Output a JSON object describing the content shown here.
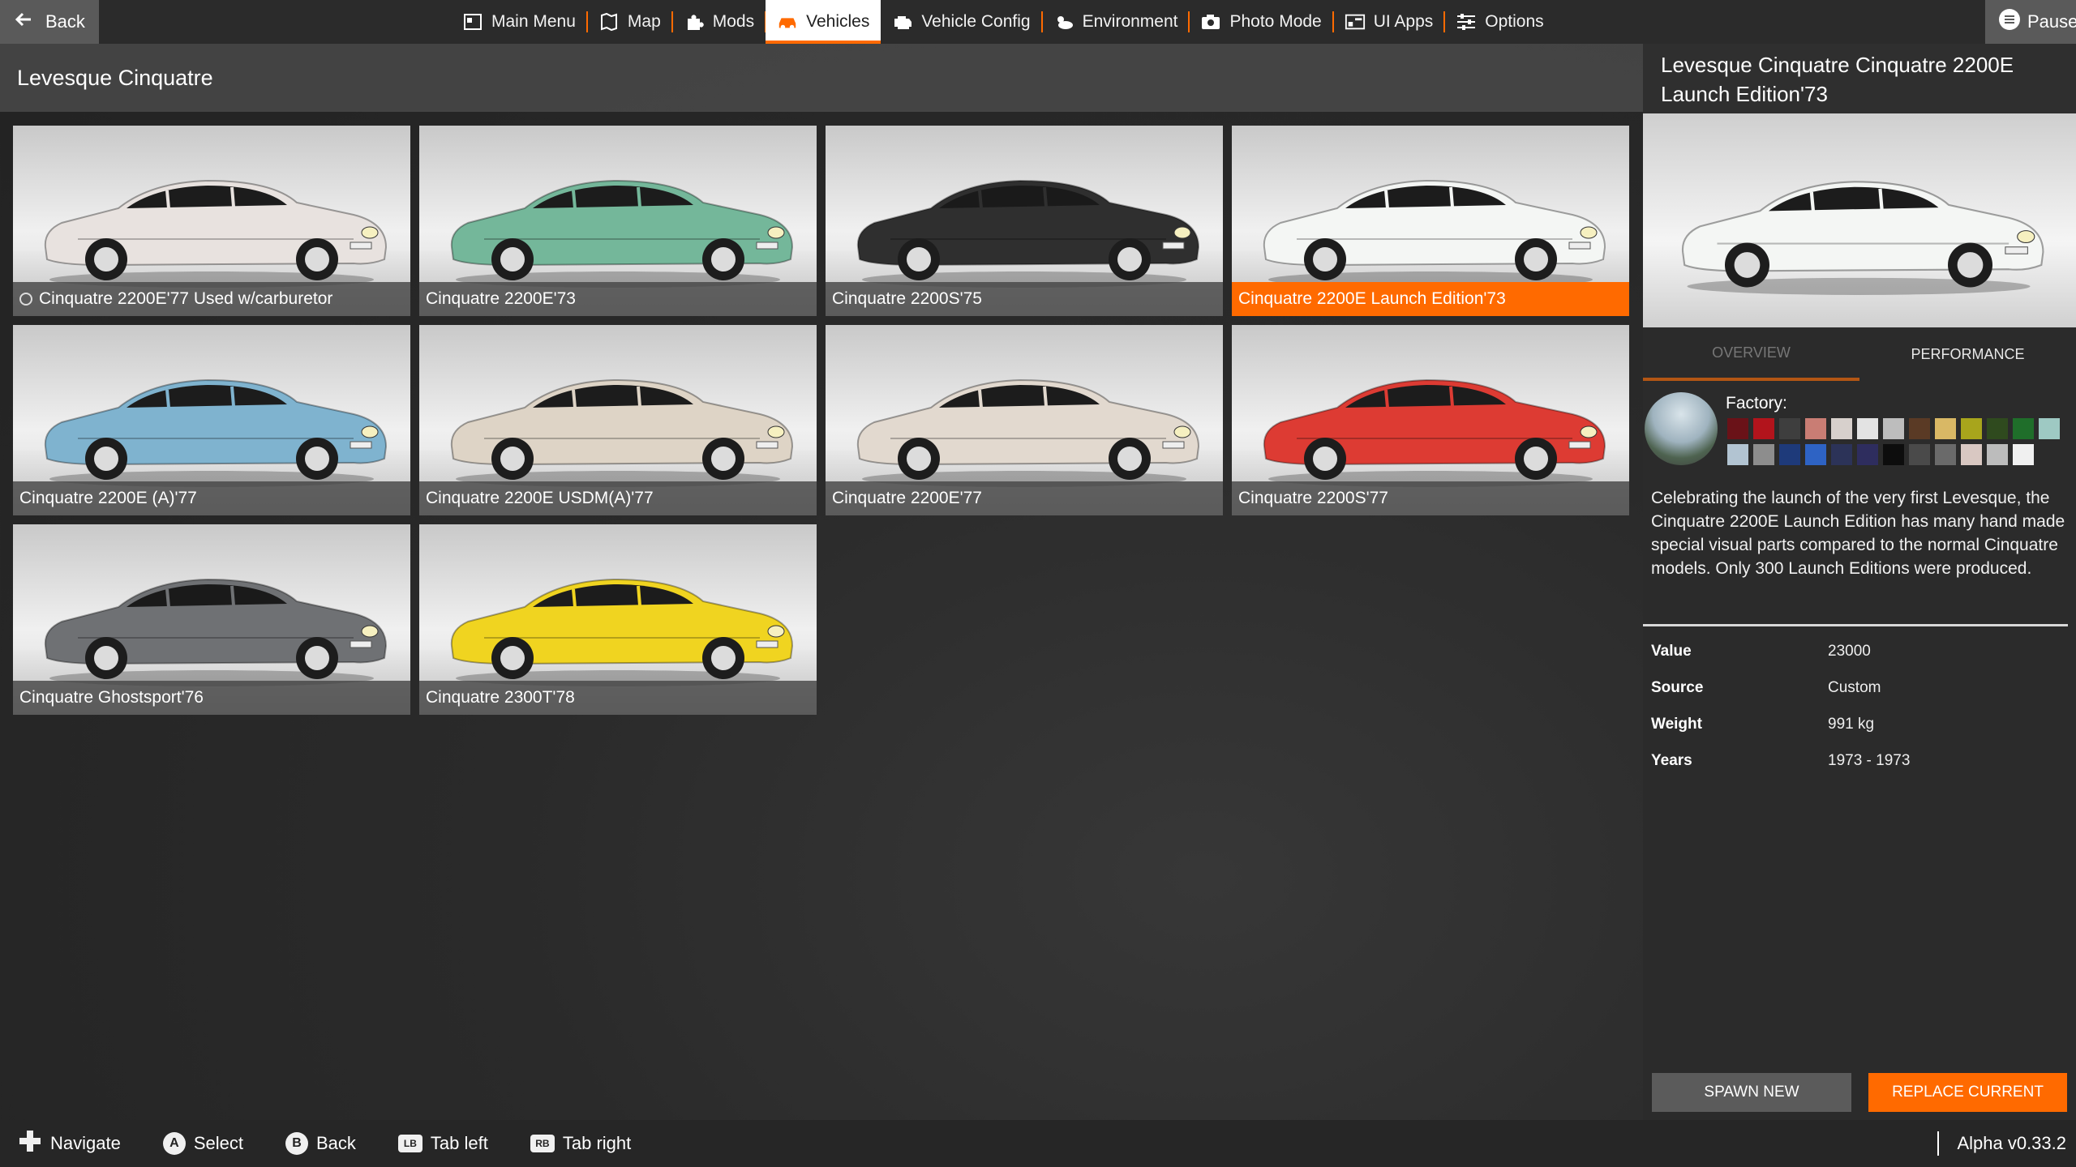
{
  "topbar": {
    "back_label": "Back",
    "pause_label": "Pause",
    "nav": [
      {
        "label": "Main Menu",
        "icon": "main-menu-icon"
      },
      {
        "label": "Map",
        "icon": "map-icon"
      },
      {
        "label": "Mods",
        "icon": "puzzle-icon"
      },
      {
        "label": "Vehicles",
        "icon": "car-icon",
        "active": true
      },
      {
        "label": "Vehicle Config",
        "icon": "engine-icon"
      },
      {
        "label": "Environment",
        "icon": "weather-icon"
      },
      {
        "label": "Photo Mode",
        "icon": "camera-icon"
      },
      {
        "label": "UI Apps",
        "icon": "ui-apps-icon"
      },
      {
        "label": "Options",
        "icon": "sliders-icon"
      }
    ]
  },
  "list": {
    "title": "Levesque Cinquatre",
    "tiles": [
      {
        "label": "Cinquatre 2200E'77 Used w/carburetor",
        "color": "#e8e2df",
        "badge": true
      },
      {
        "label": "Cinquatre 2200E'73",
        "color": "#74b79a"
      },
      {
        "label": "Cinquatre 2200S'75",
        "color": "#2f2f2f"
      },
      {
        "label": "Cinquatre 2200E Launch Edition'73",
        "color": "#f4f6f4",
        "selected": true
      },
      {
        "label": "Cinquatre 2200E (A)'77",
        "color": "#7fb3cf"
      },
      {
        "label": "Cinquatre 2200E USDM(A)'77",
        "color": "#ded4c6"
      },
      {
        "label": "Cinquatre 2200E'77",
        "color": "#e2d9cf"
      },
      {
        "label": "Cinquatre 2200S'77",
        "color": "#dd3b33"
      },
      {
        "label": "Cinquatre Ghostsport'76",
        "color": "#6f7174"
      },
      {
        "label": "Cinquatre 2300T'78",
        "color": "#f0d420"
      }
    ]
  },
  "detail": {
    "title": "Levesque Cinquatre Cinquatre 2200E Launch Edition'73",
    "preview_color": "#f4f6f4",
    "tabs": [
      "OVERVIEW",
      "PERFORMANCE"
    ],
    "factory_label": "Factory:",
    "swatches": [
      "#6a1218",
      "#b2141c",
      "#3e3e3e",
      "#c97d74",
      "#d7d0cc",
      "#e3e3e3",
      "#bdbdbd",
      "#5a3a25",
      "#d9b865",
      "#a8a51c",
      "#2f4a1e",
      "#1f6e2a",
      "#9ec9c3",
      "#b2c4d2",
      "#8d8d8d",
      "#1e3a7a",
      "#2e63c4",
      "#2c3358",
      "#2e2d5e",
      "#0d0d0d",
      "#4a4a4a",
      "#6a6a6a",
      "#d9c8c2",
      "#bcbcbc",
      "#f0f0f0"
    ],
    "description": "Celebrating the launch of the very first Levesque, the Cinquatre 2200E Launch Edition has many hand made special visual parts compared to the normal Cinquatre models. Only 300 Launch Editions were produced.",
    "stats": [
      {
        "key": "Value",
        "value": "23000"
      },
      {
        "key": "Source",
        "value": "Custom"
      },
      {
        "key": "Weight",
        "value": "991 kg"
      },
      {
        "key": "Years",
        "value": "1973 - 1973"
      }
    ],
    "spawn_label": "SPAWN NEW",
    "replace_label": "REPLACE CURRENT"
  },
  "bottombar": {
    "hints": [
      {
        "btn": "",
        "label": "Navigate",
        "icon": "dpad-icon"
      },
      {
        "btn": "A",
        "label": "Select",
        "icon": "a-button-icon"
      },
      {
        "btn": "B",
        "label": "Back",
        "icon": "b-button-icon"
      },
      {
        "btn": "LB",
        "label": "Tab left",
        "icon": "lb-button-icon"
      },
      {
        "btn": "RB",
        "label": "Tab right",
        "icon": "rb-button-icon"
      }
    ],
    "version": "Alpha v0.33.2"
  }
}
